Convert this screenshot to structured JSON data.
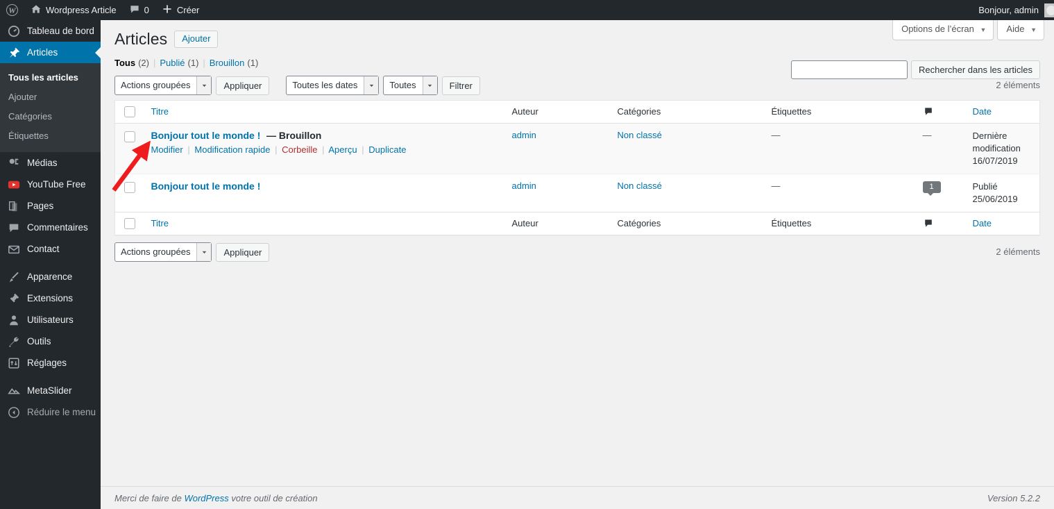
{
  "adminbar": {
    "logo_icon": "wordpress-logo-icon",
    "site_icon": "home-icon",
    "site_name": "Wordpress Article",
    "comments_icon": "comment-bubble-icon",
    "comments_count": "0",
    "new_icon": "plus-icon",
    "new_label": "Créer",
    "greeting": "Bonjour, admin"
  },
  "sidebar": {
    "items": [
      {
        "label": "Tableau de bord",
        "icon": "dashboard-icon",
        "name": "dashboard"
      },
      {
        "label": "Articles",
        "icon": "pin-icon",
        "name": "posts",
        "current": true
      },
      {
        "label": "Médias",
        "icon": "media-icon",
        "name": "media"
      },
      {
        "label": "YouTube Free",
        "icon": "youtube-icon",
        "name": "youtube-free"
      },
      {
        "label": "Pages",
        "icon": "pages-icon",
        "name": "pages"
      },
      {
        "label": "Commentaires",
        "icon": "comment-icon",
        "name": "comments"
      },
      {
        "label": "Contact",
        "icon": "envelope-icon",
        "name": "contact"
      },
      {
        "label": "Apparence",
        "icon": "appearance-icon",
        "name": "appearance"
      },
      {
        "label": "Extensions",
        "icon": "plugin-icon",
        "name": "plugins"
      },
      {
        "label": "Utilisateurs",
        "icon": "user-icon",
        "name": "users"
      },
      {
        "label": "Outils",
        "icon": "wrench-icon",
        "name": "tools"
      },
      {
        "label": "Réglages",
        "icon": "settings-icon",
        "name": "settings"
      },
      {
        "label": "MetaSlider",
        "icon": "metaslider-icon",
        "name": "metaslider"
      }
    ],
    "submenu": [
      {
        "label": "Tous les articles",
        "active": true
      },
      {
        "label": "Ajouter",
        "active": false
      },
      {
        "label": "Catégories",
        "active": false
      },
      {
        "label": "Étiquettes",
        "active": false
      }
    ],
    "collapse": {
      "label": "Réduire le menu",
      "icon": "collapse-arrow-icon"
    }
  },
  "screen_meta": {
    "screen_options": "Options de l’écran",
    "help": "Aide",
    "caret": "▼"
  },
  "header": {
    "title": "Articles",
    "add_new": "Ajouter"
  },
  "views": {
    "all_label": "Tous",
    "all_count": "(2)",
    "published_label": "Publié",
    "published_count": "(1)",
    "draft_label": "Brouillon",
    "draft_count": "(1)",
    "separator": "|"
  },
  "search": {
    "value": "",
    "placeholder": "",
    "button": "Rechercher dans les articles"
  },
  "tablenav_top": {
    "bulk_action": "Actions groupées",
    "apply": "Appliquer",
    "date_filter": "Toutes les dates",
    "category_filter": "Toutes",
    "filter_button": "Filtrer",
    "displaying_num": "2 éléments"
  },
  "tablenav_bottom": {
    "bulk_action": "Actions groupées",
    "apply": "Appliquer",
    "displaying_num": "2 éléments"
  },
  "table": {
    "columns": {
      "title": "Titre",
      "author": "Auteur",
      "categories": "Catégories",
      "tags": "Étiquettes",
      "comments_icon": "comment-bubble-icon",
      "date": "Date"
    },
    "rows": [
      {
        "title": "Bonjour tout le monde !",
        "state": "— Brouillon",
        "actions": {
          "edit": "Modifier",
          "quick_edit": "Modification rapide",
          "trash": "Corbeille",
          "preview": "Aperçu",
          "duplicate": "Duplicate",
          "sep": "|"
        },
        "author": "admin",
        "categories": "Non classé",
        "tags": "—",
        "comments": "—",
        "date_status": "Dernière modification",
        "date_value": "16/07/2019"
      },
      {
        "title": "Bonjour tout le monde !",
        "state": "",
        "actions": null,
        "author": "admin",
        "categories": "Non classé",
        "tags": "—",
        "comments": "1",
        "date_status": "Publié",
        "date_value": "25/06/2019"
      }
    ]
  },
  "footer": {
    "thanks_prefix": "Merci de faire de ",
    "wordpress_link": "WordPress",
    "thanks_suffix": " votre outil de création",
    "version": "Version 5.2.2"
  },
  "annotation": {
    "arrow_color": "#ee1c1c",
    "points_to": "Modifier"
  },
  "colors": {
    "wp_blue": "#0073aa",
    "sidebar_bg": "#23282d",
    "submenu_bg": "#32373c",
    "link": "#0073aa",
    "trash": "#b32d2e",
    "page_bg": "#f1f1f1"
  }
}
